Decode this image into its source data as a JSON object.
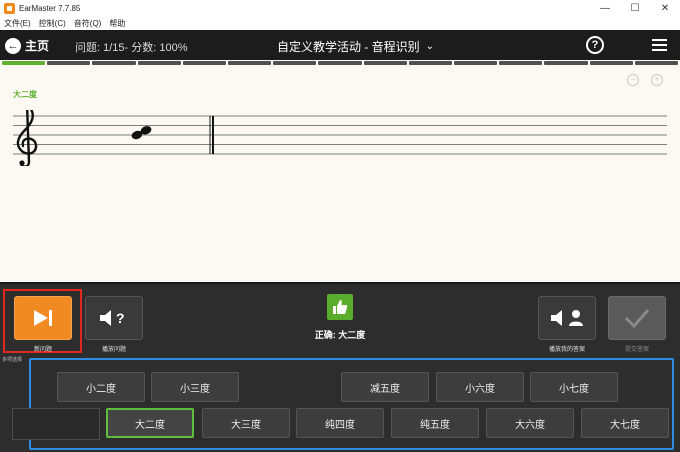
{
  "window": {
    "title": "EarMaster 7.7.85",
    "controls": [
      "—",
      "☐",
      "✕"
    ]
  },
  "menubar": [
    "文件(E)",
    "控制(C)",
    "音符(Q)",
    "帮助"
  ],
  "header": {
    "home_label": "主页",
    "stats": "问题: 1/15- 分数: 100%",
    "activity_title": "自定义教学活动 - 音程识别",
    "help_symbol": "?",
    "chevron": "⌄"
  },
  "progress": {
    "total": 15,
    "completed": 1
  },
  "score": {
    "interval_label": "大二度",
    "zoom_out": "−",
    "zoom_in": "+"
  },
  "controls": {
    "new_question_label": "新问题",
    "play_question_label": "播放问题",
    "feedback": "正确: 大二度",
    "play_answer_label": "播放我的答案",
    "submit_label": "提交答案",
    "question_mark": "?"
  },
  "answers": {
    "section_label": "多项选择",
    "row1": [
      "小二度",
      "小三度",
      "减五度",
      "小六度",
      "小七度"
    ],
    "row2": [
      "大二度",
      "大三度",
      "纯四度",
      "纯五度",
      "大六度",
      "大七度"
    ],
    "selected": "大二度"
  },
  "colors": {
    "accent_orange": "#f28a24",
    "correct_green": "#5aad2c",
    "selection_blue": "#2e8be6",
    "highlight_red": "#e0281f"
  }
}
